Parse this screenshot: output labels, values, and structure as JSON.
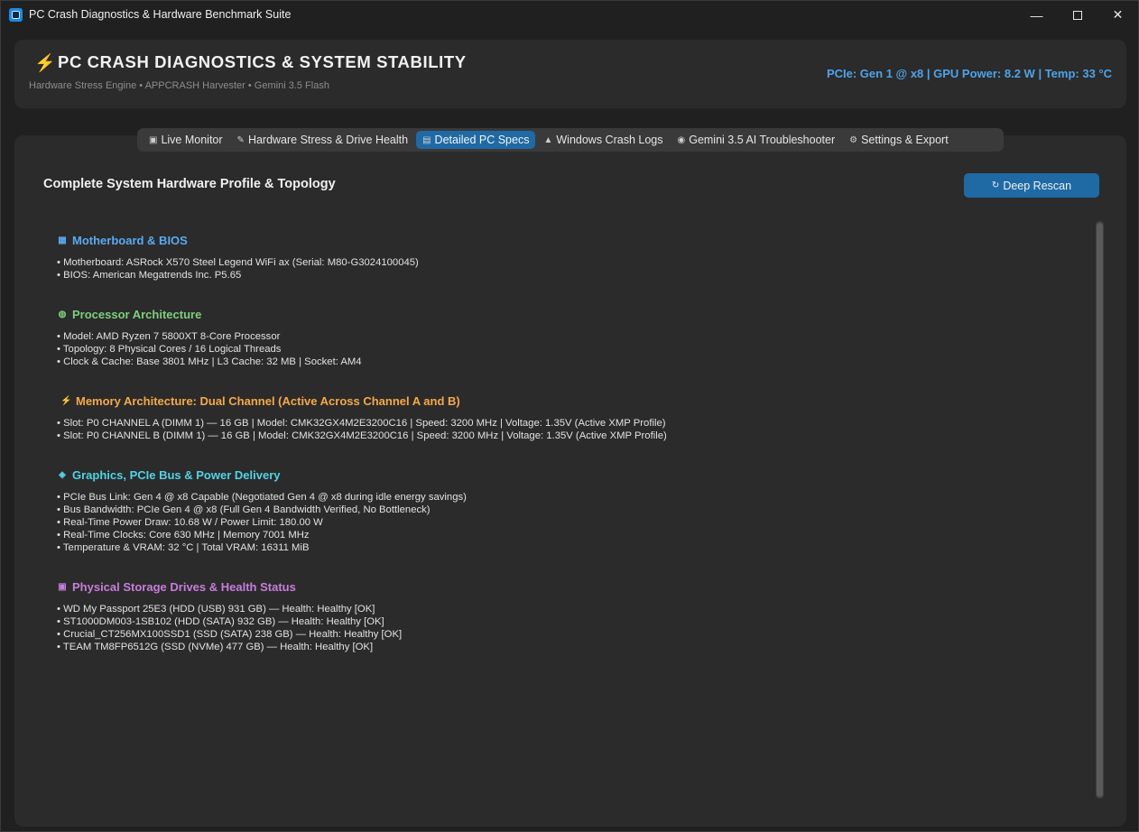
{
  "window": {
    "title": "PC Crash Diagnostics & Hardware Benchmark Suite",
    "controls": {
      "minimize": "—",
      "close": "✕"
    }
  },
  "header": {
    "bolt": "⚡",
    "title": "PC CRASH DIAGNOSTICS & SYSTEM STABILITY",
    "subtitle": "Hardware Stress Engine • APPCRASH Harvester • Gemini 3.5 Flash",
    "status": "PCIe: Gen 1 @ x8 | GPU Power: 8.2 W | Temp: 33 °C",
    "status_color": "#4ea3e8"
  },
  "tabs": [
    {
      "icon": "▣",
      "icon_name": "monitor-icon",
      "label": "Live Monitor"
    },
    {
      "icon": "✎",
      "icon_name": "brush-icon",
      "label": "Hardware Stress & Drive Health"
    },
    {
      "icon": "▤",
      "icon_name": "specs-icon",
      "label": "Detailed PC Specs"
    },
    {
      "icon": "▲",
      "icon_name": "warning-icon",
      "label": "Windows Crash Logs"
    },
    {
      "icon": "◉",
      "icon_name": "ai-icon",
      "label": "Gemini 3.5 AI Troubleshooter"
    },
    {
      "icon": "⚙",
      "icon_name": "gear-icon",
      "label": "Settings & Export"
    }
  ],
  "active_tab": "Detailed PC Specs",
  "active_color": "#1f6aa5",
  "panel": {
    "title": "Complete System Hardware Profile & Topology",
    "rescan_icon": "↻",
    "rescan_label": "Deep Rescan"
  },
  "groups": [
    {
      "icon": "▦",
      "icon_name": "motherboard-icon",
      "color": "#5aaaf0",
      "title": "Motherboard & BIOS",
      "lines": [
        "• Motherboard: ASRock X570 Steel Legend WiFi ax (Serial: M80-G3024100045)",
        "• BIOS: American Megatrends Inc. P5.65"
      ]
    },
    {
      "icon": "◍",
      "icon_name": "processor-icon",
      "color": "#7dcf7d",
      "title": "Processor Architecture",
      "lines": [
        "• Model: AMD Ryzen 7 5800XT 8-Core Processor",
        "• Topology: 8 Physical Cores / 16 Logical Threads",
        "• Clock & Cache: Base 3801 MHz | L3 Cache: 32 MB | Socket: AM4"
      ]
    },
    {
      "icon": "⚡",
      "icon_name": "bolt-icon",
      "color": "#f5a947",
      "title": "Memory Architecture: Dual Channel (Active Across Channel A and B)",
      "lines": [
        "• Slot: P0 CHANNEL A (DIMM 1) — 16 GB | Model: CMK32GX4M2E3200C16 | Speed: 3200 MHz | Voltage: 1.35V (Active XMP Profile)",
        "• Slot: P0 CHANNEL B (DIMM 1) — 16 GB | Model: CMK32GX4M2E3200C16 | Speed: 3200 MHz | Voltage: 1.35V (Active XMP Profile)"
      ]
    },
    {
      "icon": "◈",
      "icon_name": "gpu-icon",
      "color": "#4fd4e6",
      "title": "Graphics, PCIe Bus & Power Delivery",
      "lines": [
        "• PCIe Bus Link: Gen 4 @ x8 Capable (Negotiated Gen 4 @ x8 during idle energy savings)",
        "• Bus Bandwidth: PCIe Gen 4 @ x8 (Full Gen 4 Bandwidth Verified, No Bottleneck)",
        "• Real-Time Power Draw: 10.68 W / Power Limit: 180.00 W",
        "• Real-Time Clocks: Core 630 MHz | Memory 7001 MHz",
        "• Temperature & VRAM: 32 °C | Total VRAM: 16311 MiB"
      ]
    },
    {
      "icon": "▣",
      "icon_name": "drive-icon",
      "color": "#c77ddc",
      "title": "Physical Storage Drives & Health Status",
      "lines": [
        "• WD My Passport 25E3 (HDD (USB) 931 GB) — Health: Healthy [OK]",
        "• ST1000DM003-1SB102 (HDD (SATA) 932 GB) — Health: Healthy [OK]",
        "• Crucial_CT256MX100SSD1 (SSD (SATA) 238 GB) — Health: Healthy [OK]",
        "• TEAM TM8FP6512G (SSD (NVMe) 477 GB) — Health: Healthy [OK]"
      ]
    }
  ]
}
